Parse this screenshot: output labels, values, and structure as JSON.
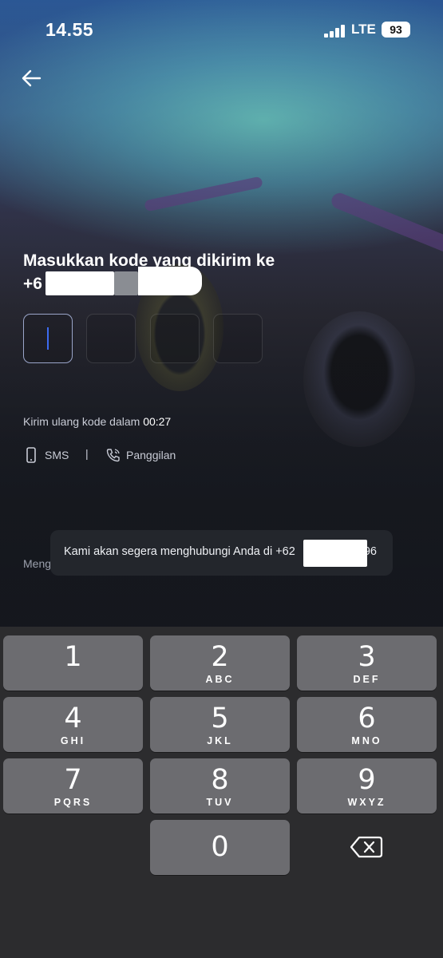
{
  "status_bar": {
    "time": "14.55",
    "network": "LTE",
    "battery": "93"
  },
  "heading": {
    "line1": "Masukkan kode yang dikirim ke",
    "line2_prefix": "+6"
  },
  "otp": {
    "length": 4,
    "active_index": 0
  },
  "resend": {
    "label": "Kirim ulang kode dalam",
    "timer": "00:27"
  },
  "methods": {
    "sms": "SMS",
    "separator": "|",
    "call": "Panggilan"
  },
  "background_text": "Meng",
  "toast": {
    "message": "Kami akan segera menghubungi Anda di +62",
    "suffix": "96"
  },
  "keypad": {
    "keys": [
      {
        "num": "1",
        "letters": ""
      },
      {
        "num": "2",
        "letters": "ABC"
      },
      {
        "num": "3",
        "letters": "DEF"
      },
      {
        "num": "4",
        "letters": "GHI"
      },
      {
        "num": "5",
        "letters": "JKL"
      },
      {
        "num": "6",
        "letters": "MNO"
      },
      {
        "num": "7",
        "letters": "PQRS"
      },
      {
        "num": "8",
        "letters": "TUV"
      },
      {
        "num": "9",
        "letters": "WXYZ"
      },
      {
        "num": "0",
        "letters": ""
      }
    ],
    "backspace_icon": "backspace-icon"
  },
  "colors": {
    "accent_cursor": "#3d6bf0",
    "keyboard_bg": "#2c2c2e",
    "key_bg": "#6c6c70"
  }
}
